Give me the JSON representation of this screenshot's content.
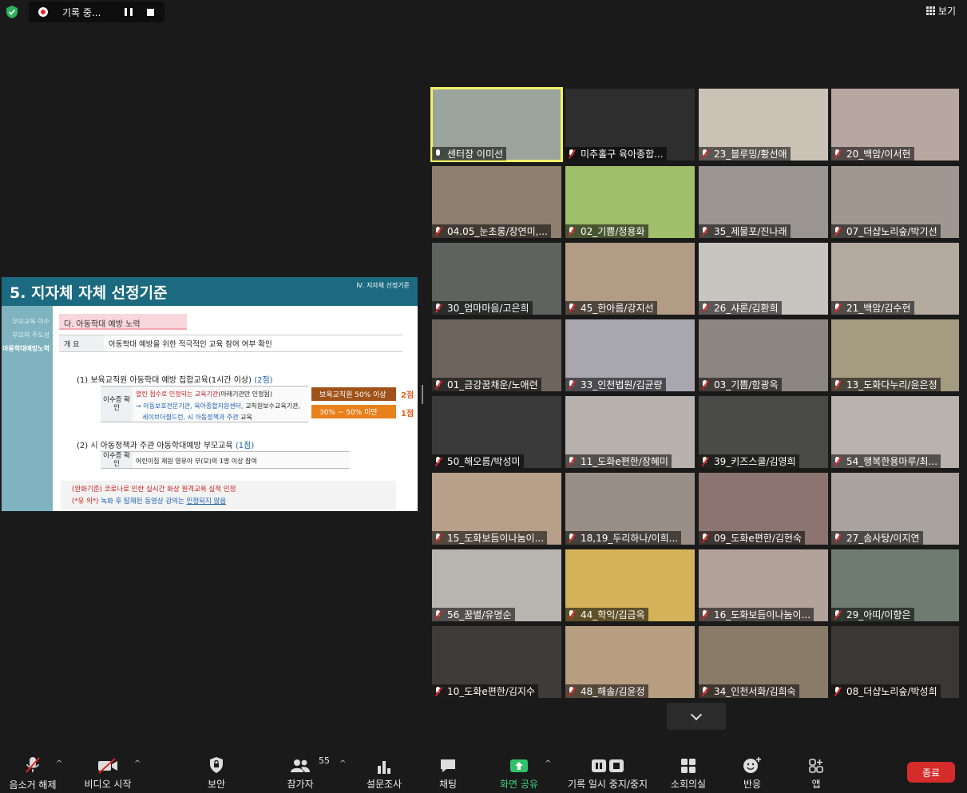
{
  "topbar": {
    "recording_label": "기록 중...",
    "view_label": "보기"
  },
  "slide": {
    "title": "5. 지자체 자체 선정기준",
    "section": "Ⅳ. 지자체 선정기준",
    "sidebar": [
      "부모교육 이수",
      "부모의 주도성",
      "아동학대예방노력"
    ],
    "box_title": "다. 아동학대 예방 노력",
    "overview_key": "개       요",
    "overview_value": "아동학대 예방을 위한 적극적인 교육 참여 여부 확인",
    "item1_prefix": "(1) 보육교직원 아동학대 예방 집합교육(1시간 이상)",
    "item1_points": "(2점)",
    "t1_key": "이수증 확 인",
    "t1_line1_red": "열린 점수로 인정되는 교육기관",
    "t1_line1_rest": "(아래기관만 인정됨)",
    "t1_line2_blue": "→ 아동보호전문기관, 육아종합지원센터,",
    "t1_line2_rest": "교직원보수교육기관,",
    "t1_line3_blue": "세이브더칠드런, 시 아동정책과 주관",
    "t1_line3_rest": "교육",
    "tag1": "보육교직원 50% 이상",
    "score1": "2점",
    "tag2": "30% ~ 50% 미만",
    "score2": "1점",
    "item2_prefix": "(2) 시 아동정책과 주관 아동학대예방 부모교육",
    "item2_points": "(1점)",
    "t2_key": "이수증 확 인",
    "t2_value": "어린이집 재원 영유아 부(모)의 1명 이상 참여",
    "note1_red": "(완화기준) 코로나로 인한 실시간 화상 원격교육 실적 인정",
    "note2_prefix": "(*유 의*)",
    "note2_blue": "녹화 후 탑재된 동영상 강의는",
    "note2_under": "인정되지 않음"
  },
  "participants": [
    {
      "name": "센터장 이미선",
      "bg": "#9aa39c",
      "active": true,
      "muted": false
    },
    {
      "name": "미추홀구 육아종합...",
      "bg": "#2e2e2e",
      "muted": true
    },
    {
      "name": "23_블루밍/황선애",
      "bg": "#c9c2b5",
      "muted": true
    },
    {
      "name": "20_백암/이서현",
      "bg": "#b8a7a0",
      "muted": true
    },
    {
      "name": "04.05_눈초롱/장연미,...",
      "bg": "#8f7f6e",
      "muted": true
    },
    {
      "name": "02_기쁨/정용화",
      "bg": "#9fbf6a",
      "muted": true
    },
    {
      "name": "35_제물포/진나래",
      "bg": "#9a9590",
      "muted": true
    },
    {
      "name": "07_더샵노리숲/박기선",
      "bg": "#a09890",
      "muted": true
    },
    {
      "name": "30_엄마마음/고은희",
      "bg": "#5e6360",
      "muted": true
    },
    {
      "name": "45_한아름/강지선",
      "bg": "#b39c86",
      "muted": true
    },
    {
      "name": "26_샤론/김환희",
      "bg": "#c7c5c0",
      "muted": true
    },
    {
      "name": "21_백암/김수현",
      "bg": "#b5aaa0",
      "muted": true
    },
    {
      "name": "01_금강꿈채운/노애련",
      "bg": "#6e645c",
      "muted": true
    },
    {
      "name": "33_인천법원/김균량",
      "bg": "#a8a7b0",
      "muted": true
    },
    {
      "name": "03_기쁨/함광옥",
      "bg": "#8c8680",
      "muted": true
    },
    {
      "name": "13_도화다누리/윤은정",
      "bg": "#a49b80",
      "muted": true
    },
    {
      "name": "50_해오름/박성미",
      "bg": "#3a3a3a",
      "muted": true
    },
    {
      "name": "11_도화e편한/장혜미",
      "bg": "#b7b2ad",
      "muted": true
    },
    {
      "name": "39_키즈스쿨/김영희",
      "bg": "#4a4a48",
      "muted": true
    },
    {
      "name": "54_행복한용마루/최...",
      "bg": "#b9b3ae",
      "muted": true
    },
    {
      "name": "15_도화보듬이나눔이...",
      "bg": "#b89f8a",
      "muted": true
    },
    {
      "name": "18,19_두리하나/이희...",
      "bg": "#9a8f86",
      "muted": true
    },
    {
      "name": "09_도화e편한/김현숙",
      "bg": "#8c7570",
      "muted": true
    },
    {
      "name": "27_솜사탕/이지연",
      "bg": "#a9a39d",
      "muted": true
    },
    {
      "name": "56_꿈별/유명순",
      "bg": "#b8b4b0",
      "muted": true
    },
    {
      "name": "44_학익/김금옥",
      "bg": "#d4b25a",
      "muted": true
    },
    {
      "name": "16_도화보듬이나눔이...",
      "bg": "#b3a29a",
      "muted": true
    },
    {
      "name": "29_아띠/이향은",
      "bg": "#6f7a70",
      "muted": true
    },
    {
      "name": "10_도화e편한/김지수",
      "bg": "#3e3c3a",
      "muted": true
    },
    {
      "name": "48_해솔/김윤정",
      "bg": "#b89e80",
      "muted": true
    },
    {
      "name": "34_인천서화/김희숙",
      "bg": "#8a7a68",
      "muted": true
    },
    {
      "name": "08_더샵노리숲/박성희",
      "bg": "#3a3836",
      "muted": true
    }
  ],
  "toolbar": {
    "unmute": "음소거 해제",
    "start_video": "비디오 시작",
    "security": "보안",
    "participants": "참가자",
    "participants_count": "55",
    "polls": "설문조사",
    "chat": "채팅",
    "share_screen": "화면 공유",
    "pause_recording": "기록 일시 중지/중지",
    "breakout": "소회의실",
    "reactions": "반응",
    "apps": "앱",
    "end": "종료"
  }
}
